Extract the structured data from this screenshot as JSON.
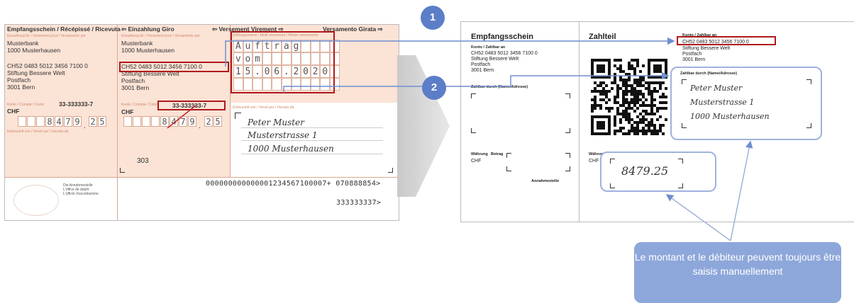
{
  "old_slip": {
    "header_receipt": "Empfangsschein / Récépissé / Ricevuta",
    "header_giro": "Einzahlung Giro",
    "header_virement": "Versement Virement",
    "header_girata": "Versamento Girata",
    "bank_label": "Einzahlung für / Versement pour / Versamento per",
    "bank_name": "Musterbank",
    "bank_city": "1000 Musterhausen",
    "account_iban": "CH52 0483 5012 3456 7100 0",
    "beneficiary_lines": [
      "Stiftung Bessere Welt",
      "Postfach",
      "3001 Bern"
    ],
    "account_label": "Konto / Compte / Conto",
    "account_number": "33-333333-7",
    "currency": "CHF",
    "amount_digits": [
      "8",
      "4",
      "7",
      "9"
    ],
    "amount_cents": [
      "2",
      "5"
    ],
    "purpose_label": "Zahlungszweck / Motif versement / Motivo versamento",
    "purpose_rows": [
      [
        "A",
        "u",
        "f",
        "t",
        "r",
        "a",
        "g"
      ],
      [
        "v",
        "o",
        "m"
      ],
      [
        "1",
        "5",
        ".",
        "0",
        "6",
        ".",
        "2",
        "0",
        "2",
        "0"
      ]
    ],
    "paid_by_label": "Einbezahlt von / Versé par / Versato da",
    "payer_lines": [
      "Peter Muster",
      "Musterstrasse 1",
      "1000 Musterhausen"
    ],
    "code_303": "303",
    "office_lines": [
      "Die Annahmestelle",
      "L'office de dépôt",
      "L'ufficio d'accettazione"
    ],
    "coding_line_1": "000000000000001234567100007+ 070888854>",
    "coding_line_2": "333333337>"
  },
  "qr_slip": {
    "receipt_title": "Empfangsschein",
    "payment_title": "Zahlteil",
    "account_label": "Konto / Zahlbar an",
    "iban": "CH52 0483 5012 3456 7100 0",
    "beneficiary_lines": [
      "Stiftung Bessere Welt",
      "Postfach",
      "3001 Bern"
    ],
    "payable_by_label": "Zahlbar durch (Name/Adresse)",
    "currency_label": "Währung",
    "amount_label": "Betrag",
    "currency": "CHF",
    "acceptance_point": "Annahmestelle",
    "payer_lines": [
      "Peter Muster",
      "Musterstrasse 1",
      "1000 Musterhausen"
    ],
    "amount": "8479.25"
  },
  "markers": [
    "1",
    "2"
  ],
  "callout": "Le montant et le débiteur peuvent toujours être saisis manuellement",
  "colors": {
    "accent_blue": "#5b7ec7",
    "highlight_red": "#b0181c",
    "slip_pink": "#fbe3d6",
    "callout_blue": "#8ea7da"
  }
}
